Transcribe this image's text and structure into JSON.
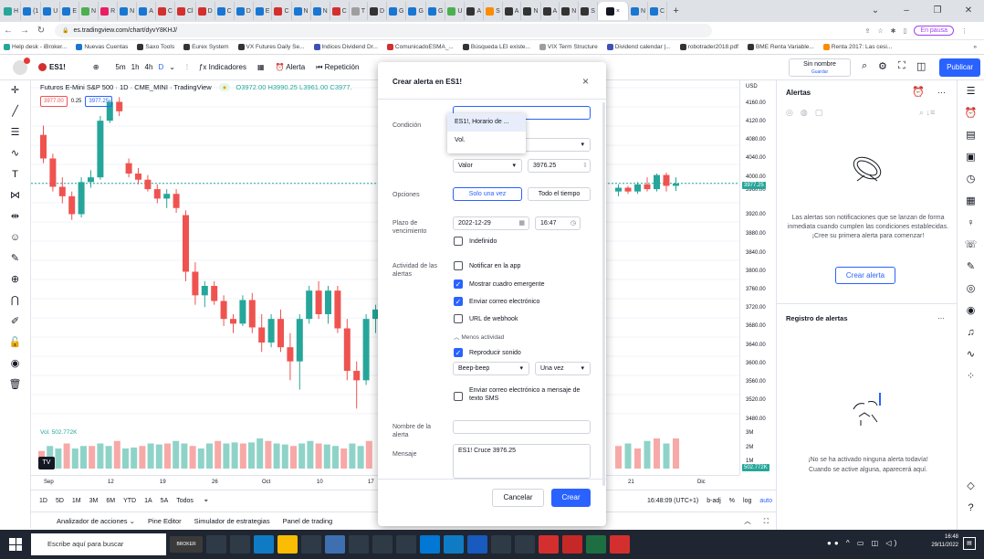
{
  "browser": {
    "tabs": [
      {
        "label": "H",
        "color": "#26a69a"
      },
      {
        "label": "(1",
        "color": "#1976d2"
      },
      {
        "label": "U",
        "color": "#1976d2"
      },
      {
        "label": "E",
        "color": "#1976d2"
      },
      {
        "label": "N",
        "color": "#4caf50"
      },
      {
        "label": "R",
        "color": "#e91e63"
      },
      {
        "label": "N",
        "color": "#1976d2"
      },
      {
        "label": "A",
        "color": "#1976d2"
      },
      {
        "label": "C",
        "color": "#d32f2f"
      },
      {
        "label": "Cl",
        "color": "#d32f2f"
      },
      {
        "label": "D",
        "color": "#d32f2f"
      },
      {
        "label": "C",
        "color": "#1976d2"
      },
      {
        "label": "D",
        "color": "#1976d2"
      },
      {
        "label": "E",
        "color": "#1976d2"
      },
      {
        "label": "C",
        "color": "#d32f2f"
      },
      {
        "label": "N",
        "color": "#1976d2"
      },
      {
        "label": "N",
        "color": "#1976d2"
      },
      {
        "label": "C",
        "color": "#d32f2f"
      },
      {
        "label": "T",
        "color": "#9e9e9e"
      },
      {
        "label": "D",
        "color": "#333333"
      },
      {
        "label": "G",
        "color": "#1976d2"
      },
      {
        "label": "G",
        "color": "#1976d2"
      },
      {
        "label": "G",
        "color": "#1976d2"
      },
      {
        "label": "U",
        "color": "#4caf50"
      },
      {
        "label": "A",
        "color": "#333333"
      },
      {
        "label": "S",
        "color": "#fb8c00"
      },
      {
        "label": "A",
        "color": "#333333"
      },
      {
        "label": "N",
        "color": "#333333"
      },
      {
        "label": "A",
        "color": "#333333"
      },
      {
        "label": "N",
        "color": "#333333"
      },
      {
        "label": "S",
        "color": "#333333"
      }
    ],
    "active_tab_close": "×",
    "extra_tabs": [
      {
        "label": "N",
        "color": "#1976d2"
      },
      {
        "label": "C",
        "color": "#1976d2"
      }
    ],
    "new_tab": "+",
    "url": "es.tradingview.com/chart/dyvY8KHJ/",
    "paused_label": "En pausa",
    "bookmarks": [
      {
        "label": "Help desk - iBroker...",
        "color": "#26a69a"
      },
      {
        "label": "Nuevas Cuentas",
        "color": "#1976d2"
      },
      {
        "label": "Saxo Tools",
        "color": "#333333"
      },
      {
        "label": "Eurex System",
        "color": "#333333"
      },
      {
        "label": "VX Futures Daily Se...",
        "color": "#333333"
      },
      {
        "label": "Indices Dividend Dr...",
        "color": "#3f51b5"
      },
      {
        "label": "ComunicadoESMA_...",
        "color": "#d32f2f"
      },
      {
        "label": "Búsqueda LEI existe...",
        "color": "#333333"
      },
      {
        "label": "VIX Term Structure",
        "color": "#9e9e9e"
      },
      {
        "label": "Dividend calendar |...",
        "color": "#3f51b5"
      },
      {
        "label": "robotrader2018.pdf",
        "color": "#333333"
      },
      {
        "label": "BME Renta Variable...",
        "color": "#333333"
      },
      {
        "label": "Renta 2017: Las cesi...",
        "color": "#fb8c00"
      }
    ],
    "more_bookmarks": "»"
  },
  "toolbar": {
    "symbol": "ES1!",
    "intervals": [
      "5m",
      "1h",
      "4h",
      "D"
    ],
    "indicators": "Indicadores",
    "alert": "Alerta",
    "replay": "Repetición",
    "layout_name": "Sin nombre",
    "saved": "Guardar",
    "publish": "Publicar"
  },
  "chart": {
    "header": "Futuros E-Mini S&P 500 · 1D · CME_MINI · TradingView",
    "ohlc": "O3972.00 H3990.25 L3961.00 C3977.",
    "sell_price": "3977.00",
    "spread": "0.25",
    "buy_price": "3977.25",
    "volume_label": "Vol.",
    "volume_value": "502.772K",
    "price_labels": [
      "USD",
      "4160.00",
      "4120.00",
      "4080.00",
      "4040.00",
      "4000.00",
      "3960.00",
      "3920.00",
      "3880.00",
      "3840.00",
      "3800.00",
      "3760.00",
      "3720.00",
      "3680.00",
      "3640.00",
      "3600.00",
      "3560.00",
      "3520.00",
      "3480.00",
      "3M",
      "2M",
      "1M"
    ],
    "current_price": "3977.25",
    "current_volume": "502.772K",
    "date_labels": [
      "Sep",
      "12",
      "19",
      "26",
      "Oct",
      "10",
      "17",
      "21",
      "Dic"
    ],
    "timeframes": [
      "1D",
      "5D",
      "1M",
      "3M",
      "6M",
      "YTD",
      "1A",
      "5A",
      "Todos"
    ],
    "clock": "16:48:09 (UTC+1)",
    "adj": "b-adj",
    "pct": "%",
    "log": "log",
    "auto": "auto",
    "panels": [
      "Analizador de acciones",
      "Pine Editor",
      "Simulador de estrategias",
      "Panel de trading"
    ]
  },
  "chart_data": {
    "type": "candlestick",
    "title": "",
    "candles": [
      {
        "o": 4080,
        "h": 4100,
        "l": 4020,
        "c": 4030
      },
      {
        "o": 4030,
        "h": 4040,
        "l": 3960,
        "c": 3970
      },
      {
        "o": 3970,
        "h": 3990,
        "l": 3935,
        "c": 3950
      },
      {
        "o": 3950,
        "h": 3960,
        "l": 3900,
        "c": 3912
      },
      {
        "o": 3912,
        "h": 3990,
        "l": 3905,
        "c": 3980
      },
      {
        "o": 3980,
        "h": 4005,
        "l": 3968,
        "c": 3990
      },
      {
        "o": 3990,
        "h": 4120,
        "l": 3985,
        "c": 4110
      },
      {
        "o": 4110,
        "h": 4155,
        "l": 4105,
        "c": 4150
      },
      {
        "o": 4150,
        "h": 4160,
        "l": 4120,
        "c": 4130
      },
      {
        "o": 4020,
        "h": 4030,
        "l": 3990,
        "c": 3998
      },
      {
        "o": 3998,
        "h": 4010,
        "l": 3975,
        "c": 3985
      },
      {
        "o": 3985,
        "h": 3995,
        "l": 3960,
        "c": 3965
      },
      {
        "o": 3965,
        "h": 3975,
        "l": 3935,
        "c": 3945
      },
      {
        "o": 3945,
        "h": 3965,
        "l": 3925,
        "c": 3955
      },
      {
        "o": 3955,
        "h": 3965,
        "l": 3915,
        "c": 3925
      },
      {
        "o": 3910,
        "h": 3920,
        "l": 3770,
        "c": 3790
      },
      {
        "o": 3790,
        "h": 3810,
        "l": 3720,
        "c": 3740
      },
      {
        "o": 3740,
        "h": 3770,
        "l": 3715,
        "c": 3760
      },
      {
        "o": 3760,
        "h": 3770,
        "l": 3720,
        "c": 3728
      },
      {
        "o": 3728,
        "h": 3740,
        "l": 3675,
        "c": 3690
      },
      {
        "o": 3690,
        "h": 3700,
        "l": 3660,
        "c": 3680
      },
      {
        "o": 3680,
        "h": 3740,
        "l": 3675,
        "c": 3730
      },
      {
        "o": 3730,
        "h": 3745,
        "l": 3660,
        "c": 3672
      },
      {
        "o": 3672,
        "h": 3700,
        "l": 3620,
        "c": 3640
      },
      {
        "o": 3640,
        "h": 3700,
        "l": 3630,
        "c": 3690
      },
      {
        "o": 3690,
        "h": 3710,
        "l": 3620,
        "c": 3630
      },
      {
        "o": 3630,
        "h": 3660,
        "l": 3560,
        "c": 3600
      },
      {
        "o": 3600,
        "h": 3700,
        "l": 3540,
        "c": 3690
      },
      {
        "o": 3690,
        "h": 3760,
        "l": 3680,
        "c": 3750
      },
      {
        "o": 3750,
        "h": 3770,
        "l": 3690,
        "c": 3700
      },
      {
        "o": 3700,
        "h": 3760,
        "l": 3680,
        "c": 3750
      },
      {
        "o": 3750,
        "h": 3760,
        "l": 3660,
        "c": 3670
      },
      {
        "o": 3670,
        "h": 3690,
        "l": 3560,
        "c": 3580
      },
      {
        "o": 3580,
        "h": 3600,
        "l": 3500,
        "c": 3560
      },
      {
        "o": 3560,
        "h": 3700,
        "l": 3550,
        "c": 3690
      },
      {
        "o": 3690,
        "h": 3720,
        "l": 3660,
        "c": 3710
      }
    ],
    "right_candles": [
      {
        "o": 3960,
        "h": 3975,
        "l": 3950,
        "c": 3968
      },
      {
        "o": 3968,
        "h": 3972,
        "l": 3955,
        "c": 3960
      },
      {
        "o": 3960,
        "h": 3980,
        "l": 3955,
        "c": 3975
      },
      {
        "o": 3975,
        "h": 3990,
        "l": 3960,
        "c": 3965
      },
      {
        "o": 3965,
        "h": 3998,
        "l": 3960,
        "c": 3995
      },
      {
        "o": 3995,
        "h": 4000,
        "l": 3960,
        "c": 3972
      },
      {
        "o": 3972,
        "h": 3990,
        "l": 3961,
        "c": 3977
      }
    ],
    "ylim": [
      3460,
      4180
    ],
    "current_price": 3977.25,
    "volume": [
      0.35,
      0.45,
      0.4,
      0.5,
      0.4,
      0.45,
      0.45,
      0.5,
      0.45,
      0.55,
      0.4,
      0.42,
      0.45,
      0.5,
      0.48,
      0.5,
      0.55,
      0.5,
      0.45,
      0.4,
      0.5,
      0.55,
      0.5,
      0.52,
      0.5,
      0.52,
      0.6,
      0.55,
      0.5,
      0.48,
      0.45,
      0.5,
      0.55,
      0.5,
      0.48,
      0.45,
      0.4,
      0.5,
      0.45,
      0.55
    ],
    "right_volume": [
      0.45,
      0.5,
      0.4,
      0.55,
      0.6,
      0.5,
      0.6
    ]
  },
  "modal": {
    "title": "Crear alerta en ES1!",
    "close": "×",
    "condition_label": "Condición",
    "dropdown_options": [
      "ES1!, Horario de ...",
      "Vol."
    ],
    "value_mode": "Valor",
    "value": "3976.25",
    "options_label": "Opciones",
    "once": "Solo una vez",
    "always": "Todo el tiempo",
    "expiry_label": "Plazo de vencimiento",
    "expiry_date": "2022-12-29",
    "expiry_time": "16:47",
    "indefinite": "Indefinido",
    "actions_label": "Actividad de las alertas",
    "actions": [
      {
        "label": "Notificar en la app",
        "checked": false
      },
      {
        "label": "Mostrar cuadro emergente",
        "checked": true
      },
      {
        "label": "Enviar correo electrónico",
        "checked": true
      },
      {
        "label": "URL de webhook",
        "checked": false
      }
    ],
    "less_activity": "Menos actividad",
    "play_sound": "Reproducir sonido",
    "sound": "Beep-beep",
    "sound_repeat": "Una vez",
    "sms": "Enviar correo electrónico a mensaje de texto SMS",
    "name_label": "Nombre de la alerta",
    "name_value": "",
    "message_label": "Mensaje",
    "message_value": "ES1! Cruce 3976.25",
    "cancel": "Cancelar",
    "create": "Crear"
  },
  "alerts_panel": {
    "title": "Alertas",
    "empty_text": "Las alertas son notificaciones que se lanzan de forma inmediata cuando cumplen las condiciones establecidas. ¡Cree su primera alerta para comenzar!",
    "create_button": "Crear alerta",
    "log_title": "Registro de alertas",
    "log_empty_1": "¡No se ha activado ninguna alerta todavía!",
    "log_empty_2": "Cuando se active alguna, aparecerá aquí."
  },
  "taskbar": {
    "search_placeholder": "Escribe aquí para buscar",
    "broker": "BROKER",
    "time": "16:48",
    "date": "29/11/2022"
  },
  "colors": {
    "up": "#26a69a",
    "down": "#ef5350",
    "accent": "#2962ff"
  }
}
